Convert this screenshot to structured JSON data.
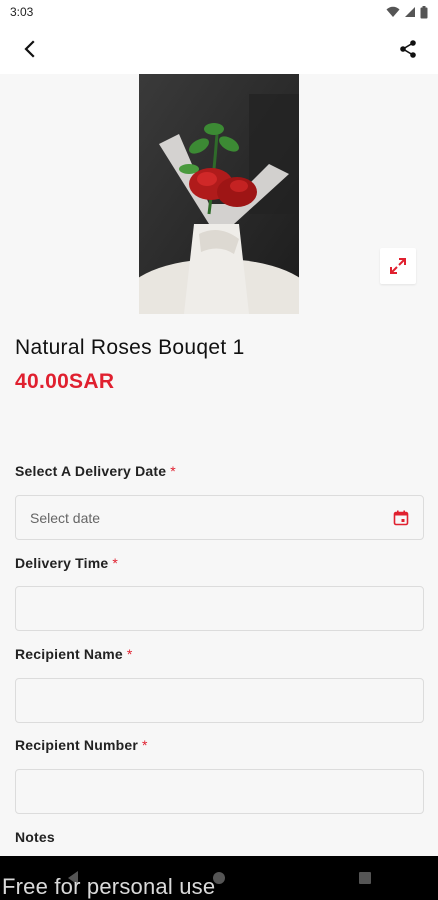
{
  "status_bar": {
    "time": "3:03"
  },
  "product": {
    "title": "Natural Roses Bouqet 1",
    "price": "40.00SAR"
  },
  "form": {
    "delivery_date_label": "Select A Delivery Date",
    "delivery_date_placeholder": "Select date",
    "delivery_time_label": "Delivery Time",
    "recipient_name_label": "Recipient Name",
    "recipient_number_label": "Recipient Number",
    "notes_label": "Notes",
    "required_mark": "*"
  },
  "watermark": "Free for personal use",
  "colors": {
    "accent": "#e0202f"
  },
  "icons": [
    "back-arrow-icon",
    "share-icon",
    "expand-icon",
    "calendar-icon"
  ]
}
